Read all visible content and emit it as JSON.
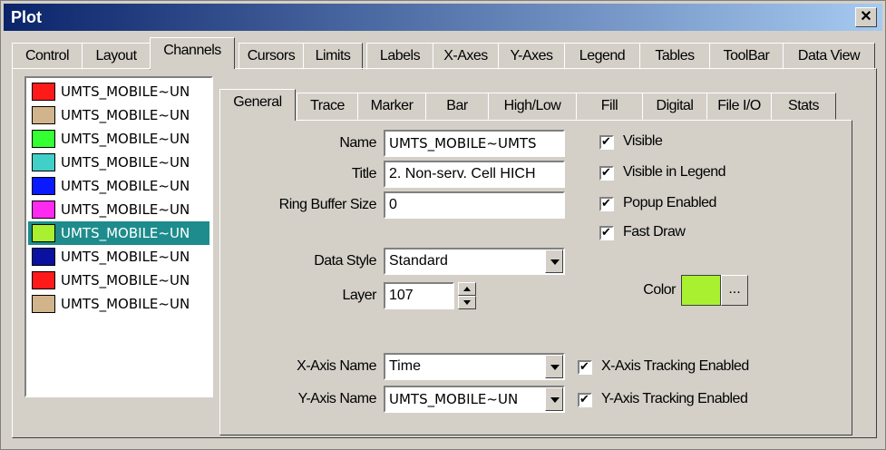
{
  "window": {
    "title": "Plot",
    "close_glyph": "✕"
  },
  "main_tabs": [
    "Control",
    "Layout",
    "Channels",
    "Cursors",
    "Limits",
    "Labels",
    "X-Axes",
    "Y-Axes",
    "Legend",
    "Tables",
    "ToolBar",
    "Data View"
  ],
  "active_main_tab": "Channels",
  "channels": [
    {
      "label": "UMTS_MOBILE~UN",
      "color": "#ff1a1a"
    },
    {
      "label": "UMTS_MOBILE~UN",
      "color": "#d2b48c"
    },
    {
      "label": "UMTS_MOBILE~UN",
      "color": "#33ff33"
    },
    {
      "label": "UMTS_MOBILE~UN",
      "color": "#40d0c8"
    },
    {
      "label": "UMTS_MOBILE~UN",
      "color": "#0a1aff"
    },
    {
      "label": "UMTS_MOBILE~UN",
      "color": "#ff2af0"
    },
    {
      "label": "UMTS_MOBILE~UN",
      "color": "#a8f030"
    },
    {
      "label": "UMTS_MOBILE~UN",
      "color": "#0a10a0"
    },
    {
      "label": "UMTS_MOBILE~UN",
      "color": "#ff1a1a"
    },
    {
      "label": "UMTS_MOBILE~UN",
      "color": "#d2b48c"
    }
  ],
  "selected_channel_index": 6,
  "sub_tabs": [
    "General",
    "Trace",
    "Marker",
    "Bar",
    "High/Low",
    "Fill",
    "Digital",
    "File I/O",
    "Stats"
  ],
  "active_sub_tab": "General",
  "general": {
    "name_label": "Name",
    "name_value": "UMTS_MOBILE~UMTS",
    "title_label": "Title",
    "title_value": "2. Non-serv. Cell HICH",
    "ring_label": "Ring Buffer Size",
    "ring_value": "0",
    "datastyle_label": "Data Style",
    "datastyle_value": "Standard",
    "layer_label": "Layer",
    "layer_value": "107",
    "color_label": "Color",
    "color_value": "#a8f030",
    "color_button": "...",
    "xaxis_label": "X-Axis Name",
    "xaxis_value": "Time",
    "yaxis_label": "Y-Axis Name",
    "yaxis_value": "UMTS_MOBILE~UN",
    "visible_label": "Visible",
    "visible_legend_label": "Visible in Legend",
    "popup_label": "Popup Enabled",
    "fastdraw_label": "Fast Draw",
    "xtrack_label": "X-Axis Tracking Enabled",
    "ytrack_label": "Y-Axis Tracking Enabled"
  }
}
